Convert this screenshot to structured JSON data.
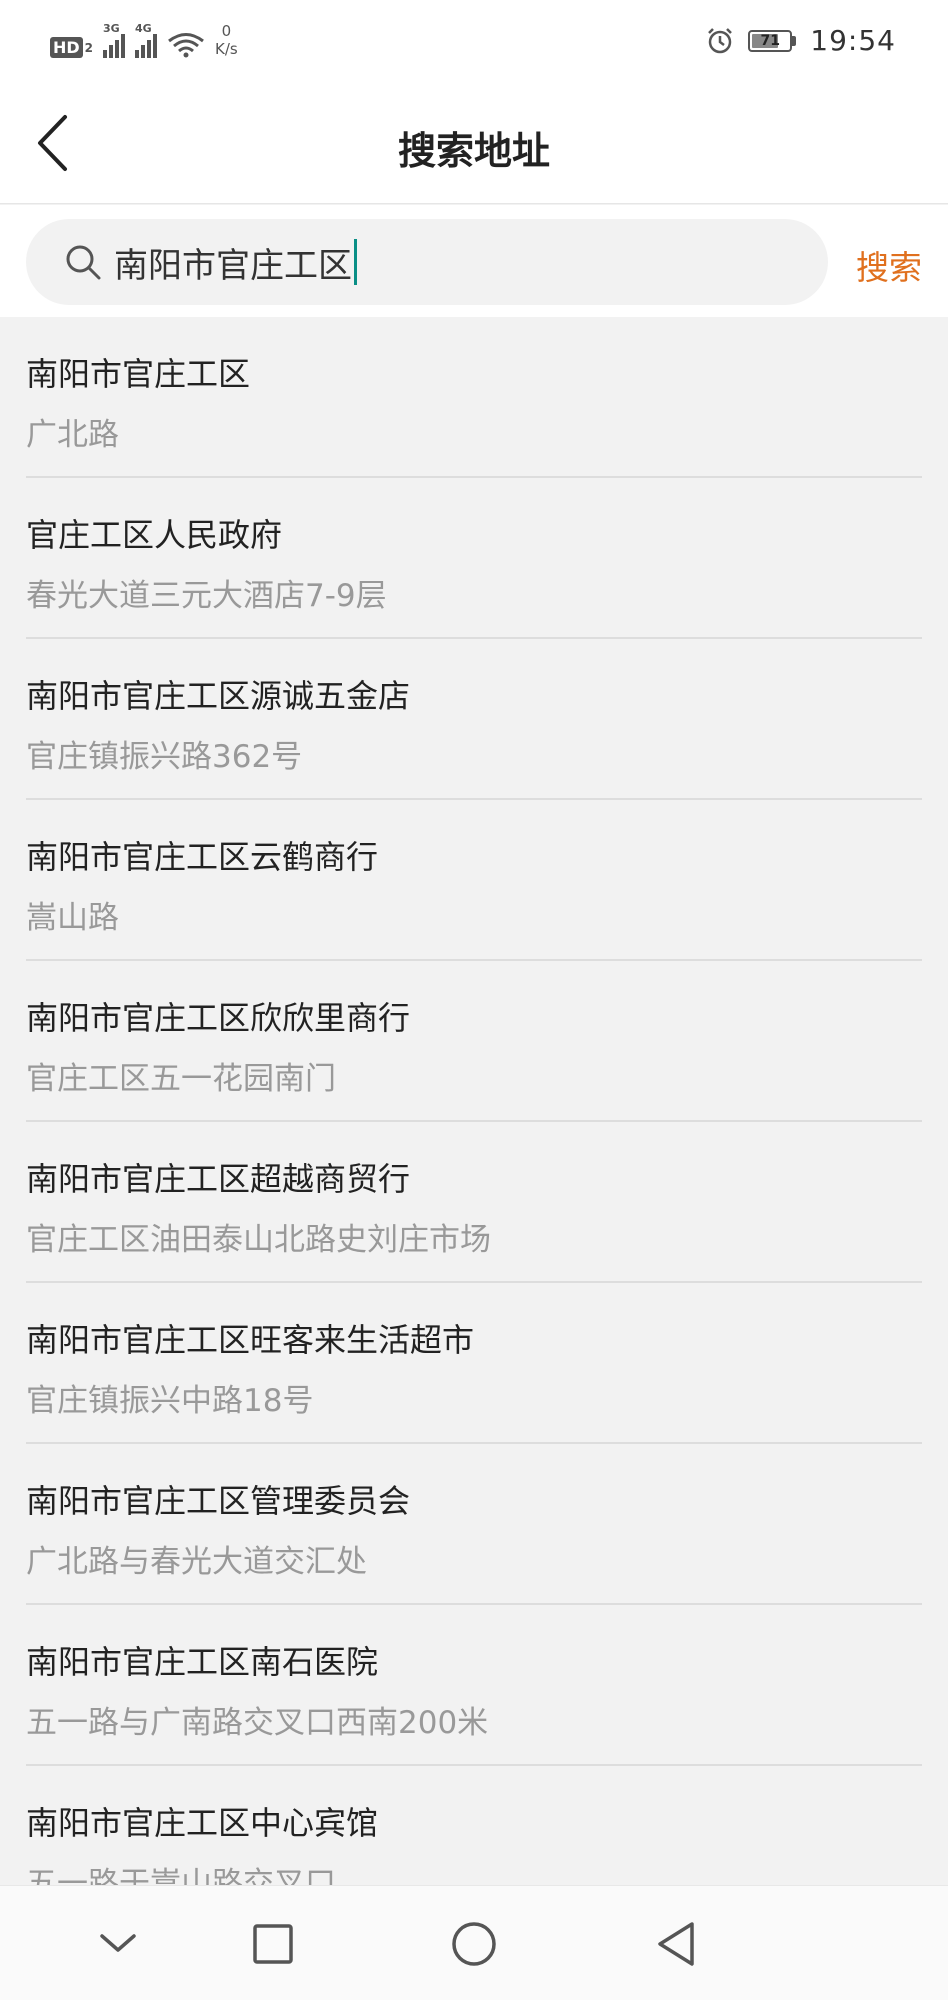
{
  "status_bar": {
    "hd_label": "HD",
    "hd_sub": "2",
    "network_1": "3G",
    "network_2": "4G",
    "speed_value": "0",
    "speed_unit": "K/s",
    "battery": "71",
    "battery_level": 0.71,
    "time": "19:54"
  },
  "header": {
    "title": "搜索地址"
  },
  "search": {
    "value": "南阳市官庄工区",
    "placeholder": "",
    "button_label": "搜索"
  },
  "results": [
    {
      "name": "南阳市官庄工区",
      "address": "广北路"
    },
    {
      "name": "官庄工区人民政府",
      "address": "春光大道三元大酒店7-9层"
    },
    {
      "name": "南阳市官庄工区源诚五金店",
      "address": "官庄镇振兴路362号"
    },
    {
      "name": "南阳市官庄工区云鹤商行",
      "address": "嵩山路"
    },
    {
      "name": "南阳市官庄工区欣欣里商行",
      "address": "官庄工区五一花园南门"
    },
    {
      "name": "南阳市官庄工区超越商贸行",
      "address": "官庄工区油田泰山北路史刘庄市场"
    },
    {
      "name": "南阳市官庄工区旺客来生活超市",
      "address": "官庄镇振兴中路18号"
    },
    {
      "name": "南阳市官庄工区管理委员会",
      "address": "广北路与春光大道交汇处"
    },
    {
      "name": "南阳市官庄工区南石医院",
      "address": "五一路与广南路交叉口西南200米"
    },
    {
      "name": "南阳市官庄工区中心宾馆",
      "address": "五一路于嵩山路交叉口"
    }
  ],
  "colors": {
    "accent": "#e0701e",
    "caret": "#0a8f86"
  },
  "icons": {
    "back": "chevron-left-icon",
    "search": "search-icon",
    "nav_hide": "chevron-down-icon",
    "nav_recents": "square-icon",
    "nav_home": "circle-icon",
    "nav_back": "triangle-back-icon"
  }
}
